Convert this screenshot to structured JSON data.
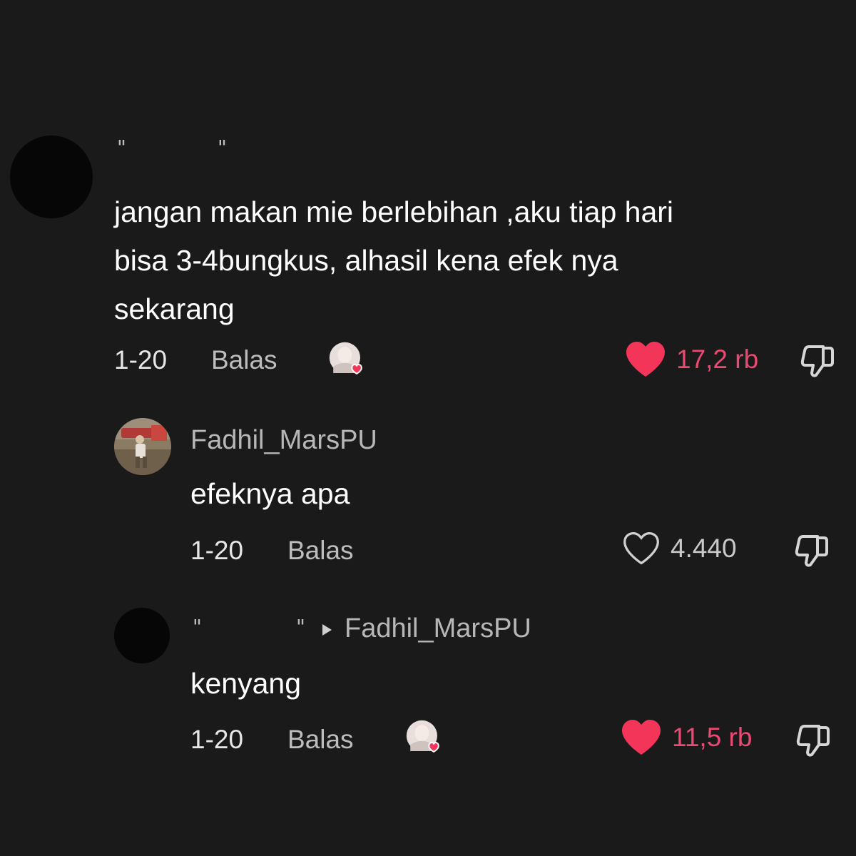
{
  "comments": [
    {
      "quote_open": "\"",
      "quote_close": "\"",
      "text_lines": [
        "jangan makan mie berlebihan ,aku tiap hari",
        "bisa 3-4bungkus, alhasil kena efek nya",
        "sekarang"
      ],
      "date": "1-20",
      "reply_label": "Balas",
      "creator_liked": true,
      "liked": true,
      "like_count": "17,2 rb"
    },
    {
      "username": "Fadhil_MarsPU",
      "text": "efeknya apa",
      "date": "1-20",
      "reply_label": "Balas",
      "creator_liked": false,
      "liked": false,
      "like_count": "4.440"
    },
    {
      "quote_open": "\"",
      "quote_close": "\"",
      "reply_to": "Fadhil_MarsPU",
      "text": "kenyang",
      "date": "1-20",
      "reply_label": "Balas",
      "creator_liked": true,
      "liked": true,
      "like_count": "11,5 rb"
    }
  ],
  "colors": {
    "background": "#1a1a1b",
    "like_red": "#f3355a",
    "like_count_red": "#ea4a72"
  },
  "icons": {
    "like": "heart-icon",
    "dislike": "thumbs-down-icon",
    "creator_like": "creator-liked-badge",
    "reply_to": "triangle-right-icon"
  }
}
